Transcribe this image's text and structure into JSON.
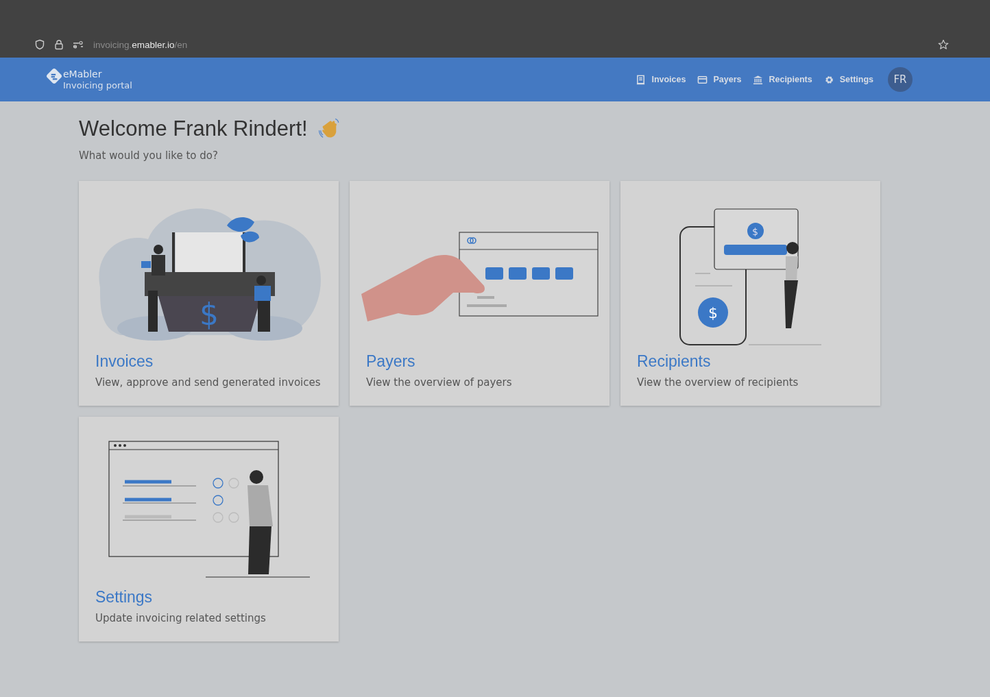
{
  "browser": {
    "url": {
      "prefix": "invoicing.",
      "domain": "emabler.io",
      "suffix": "/en"
    }
  },
  "header": {
    "brand": "eMabler",
    "subtitle": "Invoicing portal",
    "nav": [
      {
        "kind": "invoices",
        "label": "Invoices"
      },
      {
        "kind": "payers",
        "label": "Payers"
      },
      {
        "kind": "recipients",
        "label": "Recipients"
      },
      {
        "kind": "settings",
        "label": "Settings"
      }
    ],
    "avatar": "FR"
  },
  "welcome": {
    "title": "Welcome Frank Rindert!",
    "subtitle": "What would you like to do?"
  },
  "cards": [
    {
      "kind": "invoices",
      "symbols": [
        "$"
      ],
      "title": "Invoices",
      "description": "View, approve and send generated invoices"
    },
    {
      "kind": "payers",
      "title": "Payers",
      "description": "View the overview of payers"
    },
    {
      "kind": "recipients",
      "symbols": [
        "$",
        "$"
      ],
      "title": "Recipients",
      "description": "View the overview of recipients"
    },
    {
      "kind": "settings",
      "title": "Settings",
      "description": "Update invoicing related settings"
    }
  ]
}
